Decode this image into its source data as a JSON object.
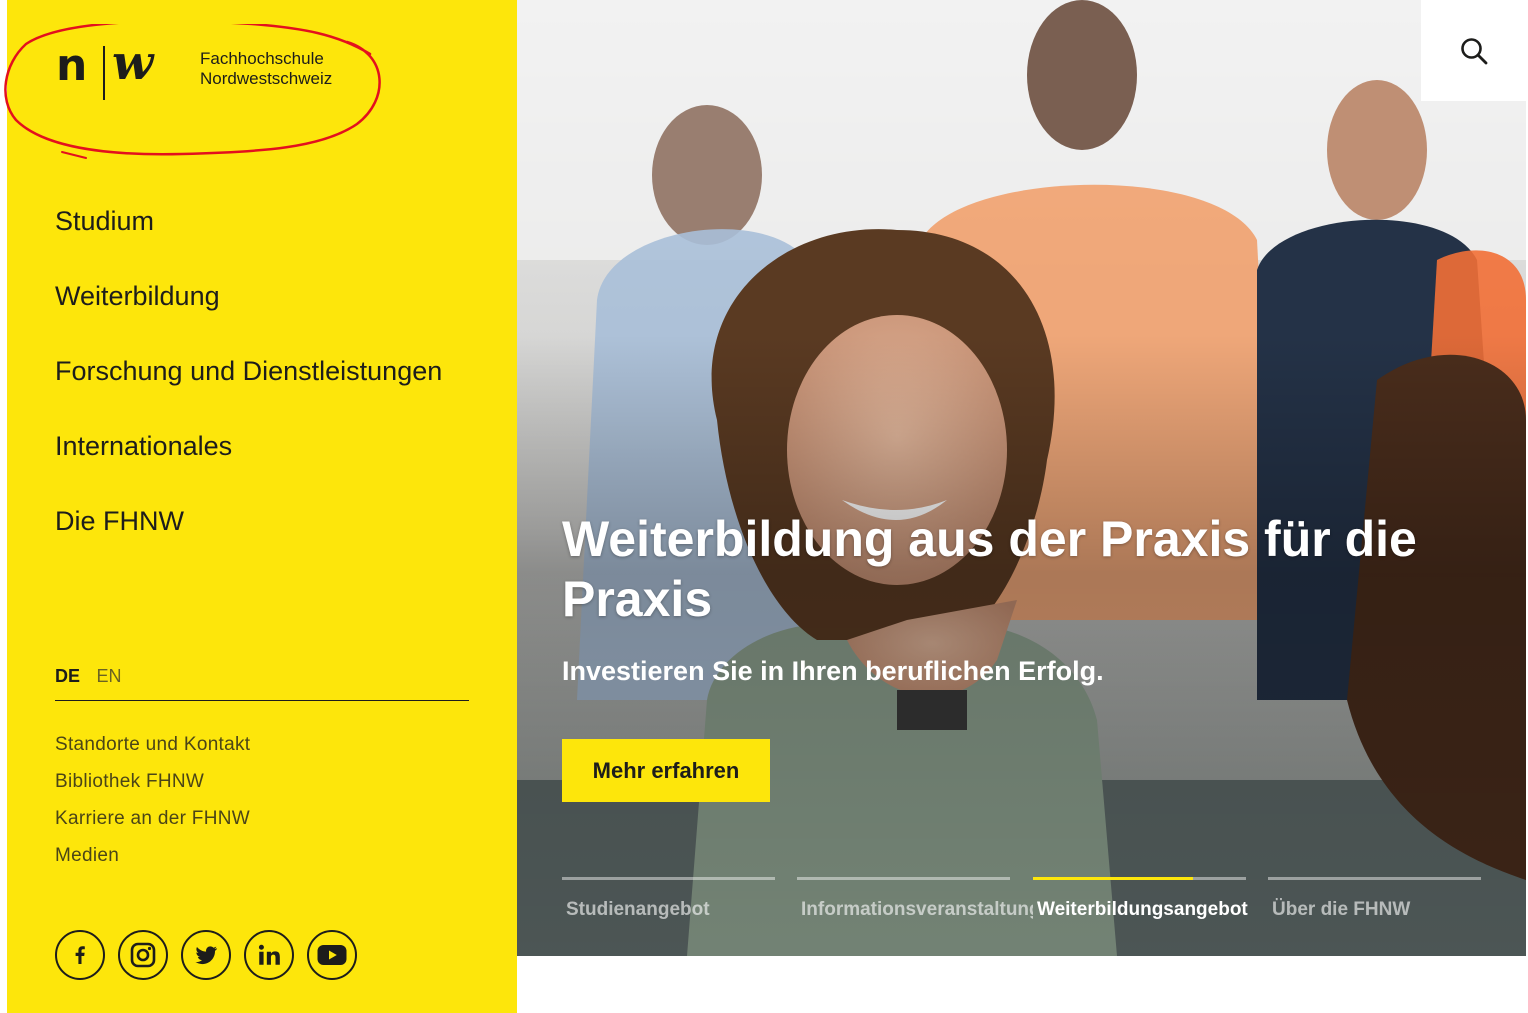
{
  "logo": {
    "line1": "Fachhochschule",
    "line2": "Nordwestschweiz",
    "glyph_n": "n",
    "glyph_w": "w"
  },
  "nav": {
    "items": [
      "Studium",
      "Weiterbildung",
      "Forschung und Dienstleistungen",
      "Internationales",
      "Die FHNW"
    ]
  },
  "language": {
    "active": "DE",
    "other": "EN"
  },
  "subnav": {
    "items": [
      "Standorte und Kontakt",
      "Bibliothek FHNW",
      "Karriere an der FHNW",
      "Medien"
    ]
  },
  "social": {
    "icons": [
      "facebook-icon",
      "instagram-icon",
      "twitter-icon",
      "linkedin-icon",
      "youtube-icon"
    ]
  },
  "hero": {
    "title": "Weiterbildung aus der Praxis für die Praxis",
    "subtitle": "Investieren Sie in Ihren beruflichen Erfolg.",
    "button_label": "Mehr erfahren"
  },
  "slider": {
    "tabs": [
      {
        "label": "Studienangebot",
        "progress": 0
      },
      {
        "label": "Informationsveranstaltungen",
        "progress": 0
      },
      {
        "label": "Weiterbildungsangebot",
        "progress": 0.75,
        "active": true
      },
      {
        "label": "Über die FHNW",
        "progress": 0
      }
    ]
  },
  "colors": {
    "brand_yellow": "#fde60b",
    "text_dark": "#1d1d1b",
    "annotation_red": "#e3101e"
  },
  "search": {
    "icon": "search-icon"
  }
}
